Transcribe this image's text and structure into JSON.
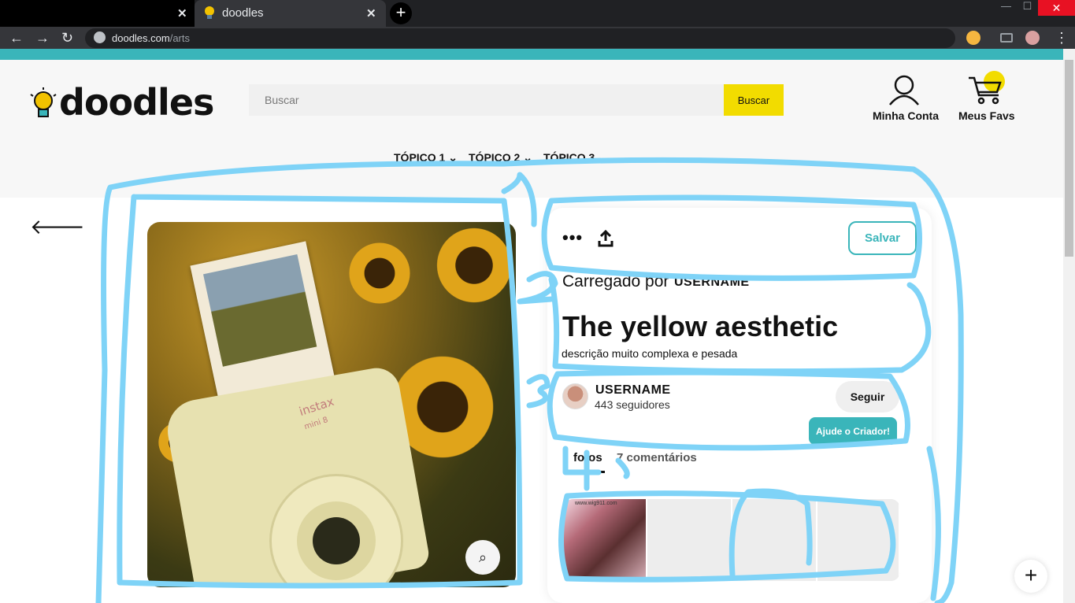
{
  "browser": {
    "tabs": [
      {
        "title": ""
      },
      {
        "title": "doodles"
      }
    ],
    "url_host": "doodles.com",
    "url_path": "/arts",
    "close_glyph": "✕",
    "new_tab_glyph": "+"
  },
  "header": {
    "logo": "doodles",
    "search_placeholder": "Buscar",
    "search_button": "Buscar",
    "account_label": "Minha Conta",
    "favs_label": "Meus Favs",
    "topics": [
      "TÓPICO 1",
      "TÓPICO 2",
      "TÓPICO 3"
    ]
  },
  "post": {
    "save_label": "Salvar",
    "uploaded_prefix": "Carregado por",
    "uploaded_user": "USERNAME",
    "title": "The yellow aesthetic",
    "description": "descrição muito complexa e pesada",
    "author": {
      "name": "USERNAME",
      "followers": "443 seguidores"
    },
    "follow_label": "Seguir",
    "help_label": "Ajude o Criador!",
    "tabs": [
      "fotos",
      "7 comentários"
    ],
    "photo_brand": "instax",
    "photo_brand_sub": "mini 8",
    "thumb_caption": "www.wig911.com"
  },
  "colors": {
    "accent": "#3ab5ba",
    "yellow": "#f2dc00",
    "scribble": "#7fd3f7"
  },
  "icons": {
    "back": "arrow-left-icon",
    "more": "more-dots-icon",
    "share": "share-icon",
    "zoom": "visual-search-icon",
    "fab": "plus-icon"
  }
}
